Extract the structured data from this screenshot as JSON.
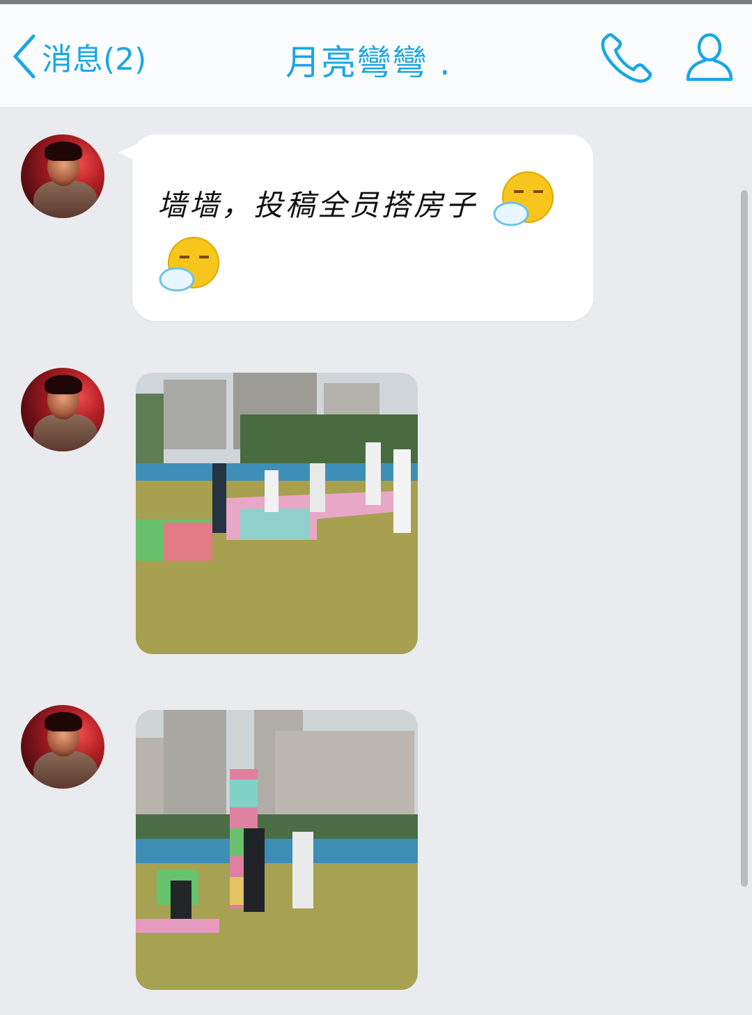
{
  "header": {
    "back_label": "消息(2)",
    "title": "月亮彎彎 .",
    "accent_color": "#1aa6e6",
    "icons": [
      "chevron-left-icon",
      "phone-icon",
      "profile-icon"
    ]
  },
  "messages": [
    {
      "type": "text",
      "text": "墙墙，投稿全员搭房子",
      "emojis": [
        "sleepy-face-emoji",
        "sleepy-face-emoji"
      ]
    },
    {
      "type": "image",
      "image_name": "students-building-foam-walls-photo"
    },
    {
      "type": "image",
      "image_name": "students-building-foam-tower-photo"
    }
  ]
}
